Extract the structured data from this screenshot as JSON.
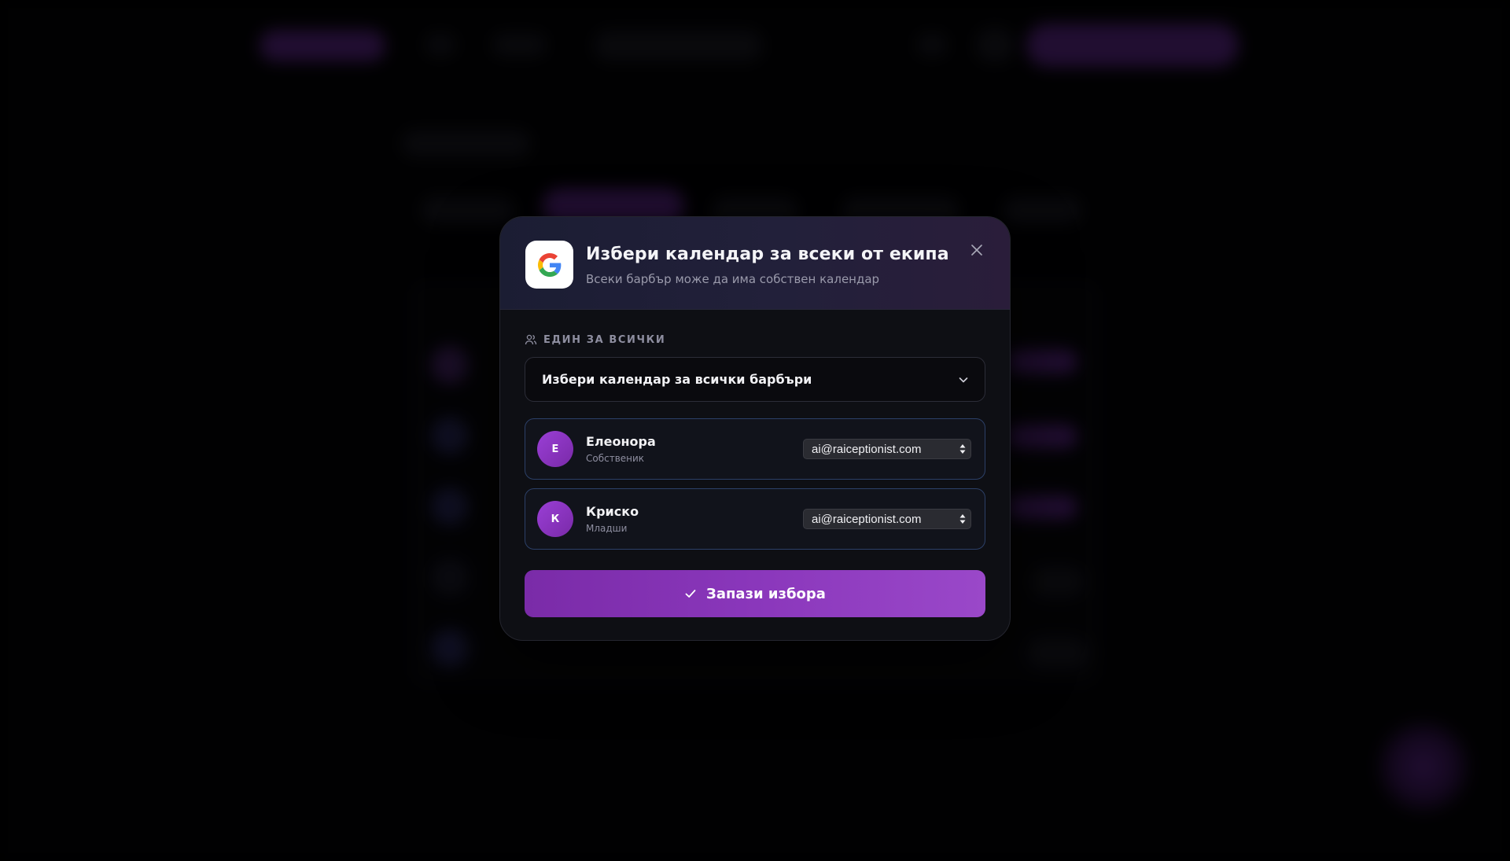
{
  "modal": {
    "title": "Избери календар за всеки от екипа",
    "subtitle": "Всеки барбър може да има собствен календар",
    "logo_icon": "google-g-icon",
    "close_icon": "close-icon"
  },
  "section": {
    "label": "ЕДИН ЗА ВСИЧКИ",
    "icon": "users-icon"
  },
  "select_all": {
    "value": "Избери календар за всички барбъри",
    "icon": "chevron-down-icon"
  },
  "members": [
    {
      "initial": "Е",
      "name": "Елеонора",
      "role": "Собственик",
      "calendar": "ai@raiceptionist.com"
    },
    {
      "initial": "К",
      "name": "Криско",
      "role": "Младши",
      "calendar": "ai@raiceptionist.com"
    }
  ],
  "save_button": {
    "label": "Запази избора",
    "icon": "check-icon"
  },
  "colors": {
    "accent": "#8a37bb",
    "member_border": "#2c4068",
    "modal_bg": "#0e0f14"
  }
}
